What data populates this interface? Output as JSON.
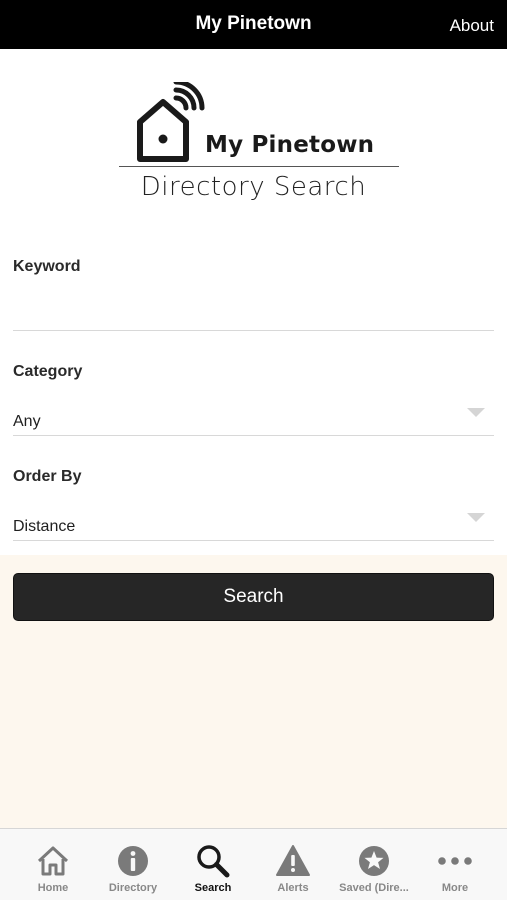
{
  "header": {
    "title": "My Pinetown",
    "about_label": "About"
  },
  "logo": {
    "brand_text": "My Pinetown",
    "subtitle": "Directory Search"
  },
  "form": {
    "keyword": {
      "label": "Keyword",
      "value": "",
      "placeholder": ""
    },
    "category": {
      "label": "Category",
      "selected": "Any"
    },
    "order_by": {
      "label": "Order By",
      "selected": "Distance"
    },
    "search_label": "Search"
  },
  "tab_bar": {
    "active": "Search",
    "items": [
      {
        "label": "Home",
        "icon": "home-icon"
      },
      {
        "label": "Directory",
        "icon": "info-icon"
      },
      {
        "label": "Search",
        "icon": "magnifier-icon"
      },
      {
        "label": "Alerts",
        "icon": "warning-icon"
      },
      {
        "label": "Saved (Dire...",
        "icon": "star-icon"
      },
      {
        "label": "More",
        "icon": "ellipsis-icon"
      }
    ]
  },
  "colors": {
    "header_bg": "#000000",
    "page_bg": "#fdf7ee",
    "button_bg": "#262626",
    "active_tab": "#111111",
    "inactive_tab": "#888888"
  }
}
